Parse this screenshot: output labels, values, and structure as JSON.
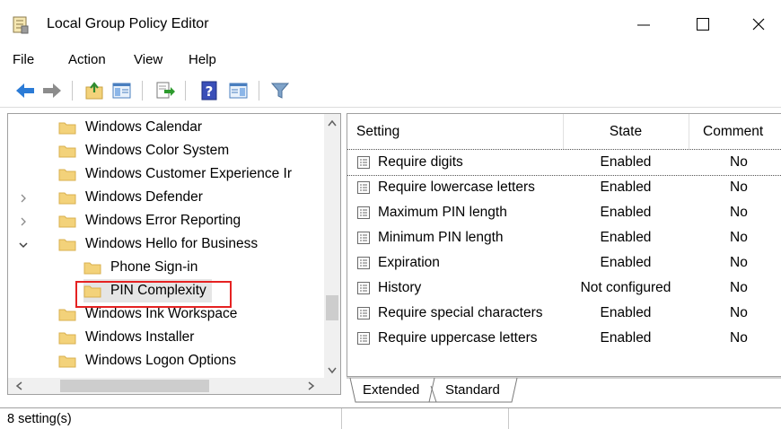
{
  "window": {
    "title": "Local Group Policy Editor",
    "min_glyph": "—",
    "max_glyph": "☐",
    "close_glyph": "✕"
  },
  "menu": [
    "File",
    "Action",
    "View",
    "Help"
  ],
  "toolbar": {
    "buttons": [
      "back-arrow-icon",
      "forward-arrow-icon",
      "up-folder-icon",
      "show-hide-tree-icon",
      "export-list-icon",
      "help-icon",
      "properties-icon",
      "filter-icon"
    ]
  },
  "tree": {
    "items": [
      {
        "label": "Windows Calendar",
        "indent": 0,
        "expander": ""
      },
      {
        "label": "Windows Color System",
        "indent": 0,
        "expander": ""
      },
      {
        "label": "Windows Customer Experience Ir",
        "indent": 0,
        "expander": ""
      },
      {
        "label": "Windows Defender",
        "indent": 0,
        "expander": "collapsed"
      },
      {
        "label": "Windows Error Reporting",
        "indent": 0,
        "expander": "collapsed"
      },
      {
        "label": "Windows Hello for Business",
        "indent": 0,
        "expander": "expanded"
      },
      {
        "label": "Phone Sign-in",
        "indent": 1,
        "expander": ""
      },
      {
        "label": "PIN Complexity",
        "indent": 1,
        "expander": "",
        "selected": true
      },
      {
        "label": "Windows Ink Workspace",
        "indent": 0,
        "expander": ""
      },
      {
        "label": "Windows Installer",
        "indent": 0,
        "expander": ""
      },
      {
        "label": "Windows Logon Options",
        "indent": 0,
        "expander": ""
      }
    ]
  },
  "table": {
    "headers": {
      "setting": "Setting",
      "state": "State",
      "comment": "Comment"
    },
    "rows": [
      {
        "setting": "Require digits",
        "state": "Enabled",
        "comment": "No"
      },
      {
        "setting": "Require lowercase letters",
        "state": "Enabled",
        "comment": "No"
      },
      {
        "setting": "Maximum PIN length",
        "state": "Enabled",
        "comment": "No"
      },
      {
        "setting": "Minimum PIN length",
        "state": "Enabled",
        "comment": "No"
      },
      {
        "setting": "Expiration",
        "state": "Enabled",
        "comment": "No"
      },
      {
        "setting": "History",
        "state": "Not configured",
        "comment": "No"
      },
      {
        "setting": "Require special characters",
        "state": "Enabled",
        "comment": "No"
      },
      {
        "setting": "Require uppercase letters",
        "state": "Enabled",
        "comment": "No"
      }
    ]
  },
  "tabs": {
    "extended": "Extended",
    "standard": "Standard",
    "active": "Standard"
  },
  "status": {
    "text": "8 setting(s)"
  },
  "colors": {
    "folder": "#f3d27a",
    "folder_border": "#d9b04f",
    "highlight": "#e52222",
    "selected_bg": "#e5e5e5"
  }
}
